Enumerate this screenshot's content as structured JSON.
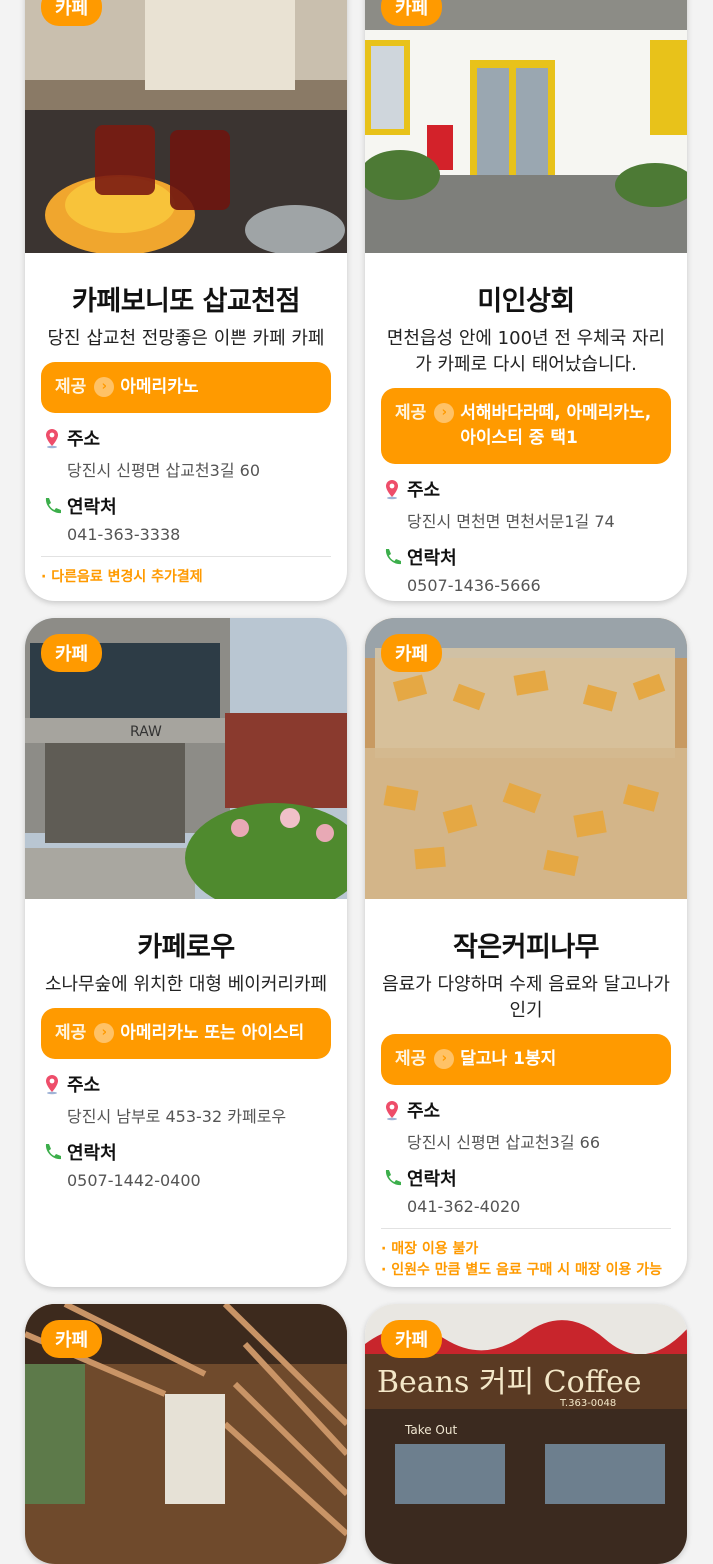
{
  "badge_label": "카페",
  "labels": {
    "offer": "제공",
    "address": "주소",
    "contact": "연락처"
  },
  "cards": [
    {
      "title": "카페보니또 삽교천점",
      "desc": "당진 삽교천 전망좋은 이쁜 카페 카페",
      "offer": "아메리카노",
      "address": "당진시 신평면 삽교천3길 60",
      "phone": "041-363-3338",
      "notes": [
        "· 다른음료 변경시 추가결제"
      ]
    },
    {
      "title": "미인상회",
      "desc": "면천읍성 안에 100년 전 우체국 자리가 카페로 다시 태어났습니다.",
      "offer": "서해바다라떼, 아메리카노, 아이스티 중 택1",
      "address": "당진시 면천면 면천서문1길 74",
      "phone": "0507-1436-5666",
      "notes": []
    },
    {
      "title": "카페로우",
      "desc": "소나무숲에 위치한 대형 베이커리카페",
      "offer": "아메리카노 또는 아이스티",
      "address": "당진시 남부로 453-32 카페로우",
      "phone": "0507-1442-0400",
      "notes": []
    },
    {
      "title": "작은커피나무",
      "desc": "음료가 다양하며 수제 음료와 달고나가 인기",
      "offer": "달고나 1봉지",
      "address": "당진시 신평면 삽교천3길 66",
      "phone": "041-362-4020",
      "notes": [
        "· 매장 이용 불가",
        "· 인원수 만큼 별도 음료 구매 시 매장 이용 가능"
      ]
    }
  ],
  "photo_texts": {
    "card3_sign": "RAW",
    "card6_sign": "Beans 커피 Coffee",
    "card6_phone": "T.363-0048",
    "card6_takeout": "Take Out"
  },
  "colors": {
    "accent": "#ff9a00",
    "background": "#f3f3f3",
    "card": "#ffffff"
  }
}
